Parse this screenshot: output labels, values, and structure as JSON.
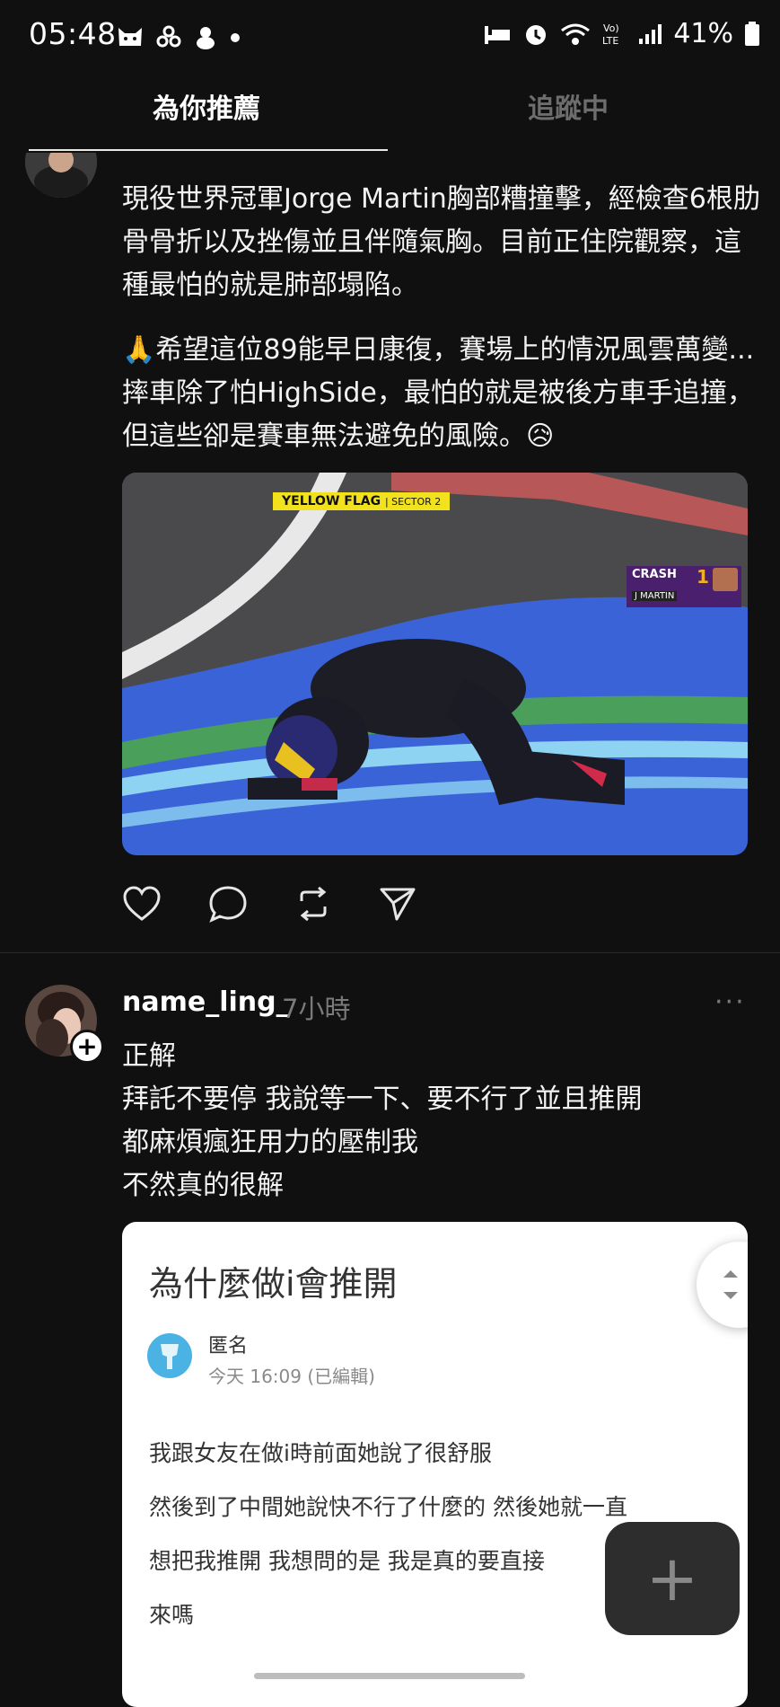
{
  "status_bar": {
    "time": "05:48",
    "battery": "41%",
    "icons": [
      "cat-icon",
      "flower-icon",
      "animal-icon",
      "dot-icon",
      "bed-icon",
      "alarm-icon",
      "wifi-icon",
      "volte-icon",
      "signal-icon",
      "battery-icon"
    ],
    "volte_label": "Vo)\nLTE"
  },
  "tabs": {
    "recommended": "為你推薦",
    "following": "追蹤中"
  },
  "post1": {
    "paragraph1": "現役世界冠軍Jorge Martin胸部糟撞擊，經檢查6根肋骨骨折以及挫傷並且伴隨氣胸。目前正住院觀察，這種最怕的就是肺部塌陷。",
    "paragraph2": "🙏希望這位89能早日康復，賽場上的情況風雲萬變...摔車除了怕HighSide，最怕的就是被後方車手追撞，但這些卻是賽車無法避免的風險。😥",
    "media": {
      "flag_label": "YELLOW FLAG",
      "sector_label": "SECTOR 2",
      "crash_label": "CRASH",
      "rider_number": "1",
      "rider_name": "J MARTIN"
    },
    "actions": [
      "heart-icon",
      "comment-icon",
      "repost-icon",
      "share-icon"
    ]
  },
  "post2": {
    "username": "name_ling_",
    "time": "7小時",
    "more": "···",
    "text_lines": [
      "正解",
      "拜託不要停 我說等一下、要不行了並且推開",
      "都麻煩瘋狂用力的壓制我",
      "不然真的很解"
    ],
    "card": {
      "title": "為什麼做i會推開",
      "author": "匿名",
      "date": "今天 16:09 (已編輯)",
      "body_lines": [
        "我跟女友在做i時前面她說了很舒服",
        "然後到了中間她說快不行了什麼的 然後她就一直",
        "想把我推開 我想問的是 我是真的要直接",
        "來嗎"
      ]
    }
  },
  "fab": {
    "label": "+"
  },
  "colors": {
    "background": "#101010",
    "text": "#f3f3f3",
    "muted": "#7a7a7a",
    "track_blue": "#3a63d8"
  }
}
